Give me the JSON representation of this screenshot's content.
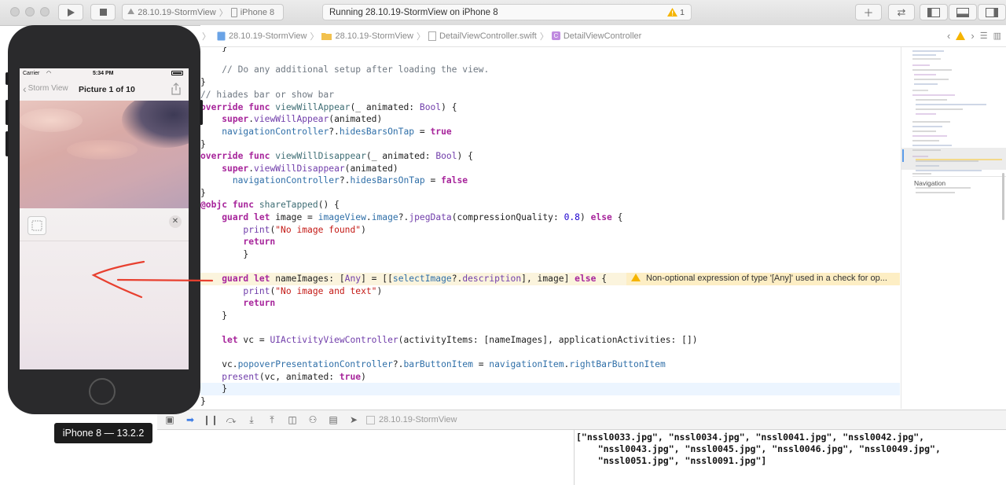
{
  "toolbar": {
    "scheme_target": "28.10.19-StormView",
    "scheme_device": "iPhone 8",
    "status_text": "Running 28.10.19-StormView on iPhone 8",
    "warning_count": "1"
  },
  "jumpbar": {
    "crumbs": [
      "28.10.19-StormView",
      "28.10.19-StormView",
      "DetailViewController.swift",
      "DetailViewController"
    ]
  },
  "code": {
    "lines": [
      "    }",
      "    // Do any additional setup after loading the view.",
      "}",
      "// hiades bar or show bar",
      "override func viewWillAppear(_ animated: Bool) {",
      "    super.viewWillAppear(animated)",
      "    navigationController?.hidesBarsOnTap = true",
      "}",
      "override func viewWillDisappear(_ animated: Bool) {",
      "    super.viewWillDisappear(animated)",
      "     navigationController?.hidesBarsOnTap = false",
      "}",
      "@objc func shareTapped() {",
      "    guard let image = imageView.image?.jpegData(compressionQuality: 0.8) else {",
      "        print(\"No image found\")",
      "        return",
      "        }",
      "",
      "    guard let nameImages: [Any] = [[selectImage?.description], image] else {",
      "        print(\"No image and text\")",
      "        return",
      "    }",
      "",
      "    let vc = UIActivityViewController(activityItems: [nameImages], applicationActivities: [])",
      "",
      "    vc.popoverPresentationController?.barButtonItem = navigationItem.rightBarButtonItem",
      "    present(vc, animated: true)",
      "    }",
      "}"
    ],
    "warning_message": "Non-optional expression of type '[Any]' used in a check for op..."
  },
  "minimap": {
    "section_label": "Navigation"
  },
  "debug": {
    "target": "28.10.19-StormView"
  },
  "console": {
    "output": "[\"nssl0033.jpg\", \"nssl0034.jpg\", \"nssl0041.jpg\", \"nssl0042.jpg\",\n    \"nssl0043.jpg\", \"nssl0045.jpg\", \"nssl0046.jpg\", \"nssl0049.jpg\",\n    \"nssl0051.jpg\", \"nssl0091.jpg\"]"
  },
  "simulator": {
    "carrier": "Carrier",
    "time": "5:34 PM",
    "back_label": "Storm View",
    "nav_title": "Picture 1 of 10",
    "device_label": "iPhone 8 — 13.2.2"
  },
  "colors": {
    "keyword": "#a7259b",
    "string": "#c41a16",
    "number": "#1c00cf",
    "annotation_arrow": "#e8402f",
    "warning": "#f5b400"
  }
}
